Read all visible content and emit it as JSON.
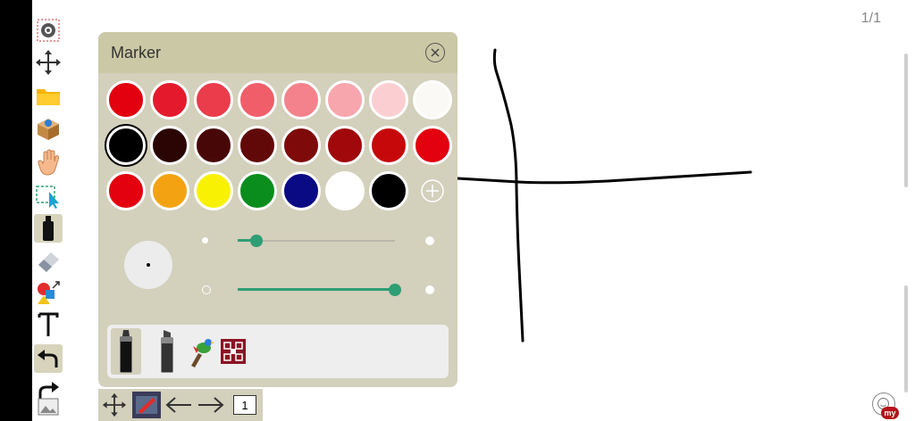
{
  "page": {
    "counter": "1/1"
  },
  "panel": {
    "title": "Marker",
    "swatch_rows": [
      [
        "#e3000f",
        "#e41a2c",
        "#eb3c4b",
        "#f05e6a",
        "#f4828c",
        "#f7a6ad",
        "#fbcfd2",
        "#fbf9f6"
      ],
      [
        "#000000",
        "#2b0404",
        "#470707",
        "#610909",
        "#7e0a0a",
        "#a0080b",
        "#c6080b",
        "#e3000f"
      ],
      [
        "#e3000f",
        "#f3a312",
        "#f9f104",
        "#0a8d1c",
        "#0a0a85",
        "#ffffff",
        "#000000"
      ]
    ],
    "selected_color": "#000000",
    "size_slider_value": 0.12,
    "opacity_slider_value": 1.0
  },
  "icons": {
    "toolbar": [
      "settings-icon",
      "move-icon",
      "folder-icon",
      "package-icon",
      "hand-icon",
      "select-icon",
      "marker-icon",
      "eraser-icon",
      "shapes-icon",
      "text-icon",
      "undo-icon",
      "redo-icon"
    ],
    "pens": [
      "marker-pen-icon",
      "highlighter-pen-icon",
      "bird-pen-icon",
      "pattern-pen-icon"
    ]
  },
  "bottom": {
    "page_label": "1"
  },
  "colors": {
    "accent": "#2e9e74",
    "panel": "#d3d0bc",
    "header": "#cbc8a5"
  }
}
